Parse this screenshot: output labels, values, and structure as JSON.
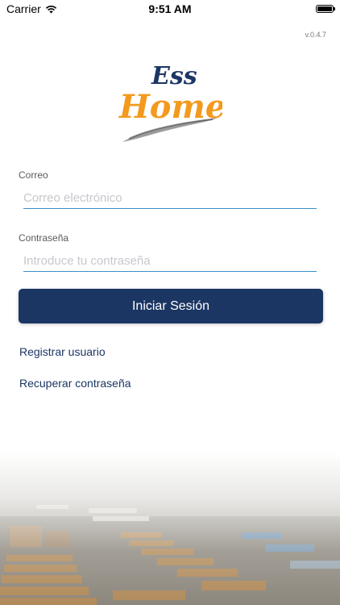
{
  "status_bar": {
    "carrier": "Carrier",
    "time": "9:51 AM"
  },
  "version": "v.0.4.7",
  "logo": {
    "line1": "Ess",
    "line2": "Home"
  },
  "email": {
    "label": "Correo",
    "placeholder": "Correo electrónico",
    "value": ""
  },
  "password": {
    "label": "Contraseña",
    "placeholder": "Introduce tu contraseña",
    "value": ""
  },
  "login_button": "Iniciar Sesión",
  "links": {
    "register": "Registrar usuario",
    "recover": "Recuperar contraseña"
  },
  "colors": {
    "primary": "#1c3664",
    "accent_orange": "#f39a1e",
    "input_line": "#3a8fc8"
  },
  "icons": {
    "signal": "wifi-icon",
    "battery": "battery-icon"
  }
}
